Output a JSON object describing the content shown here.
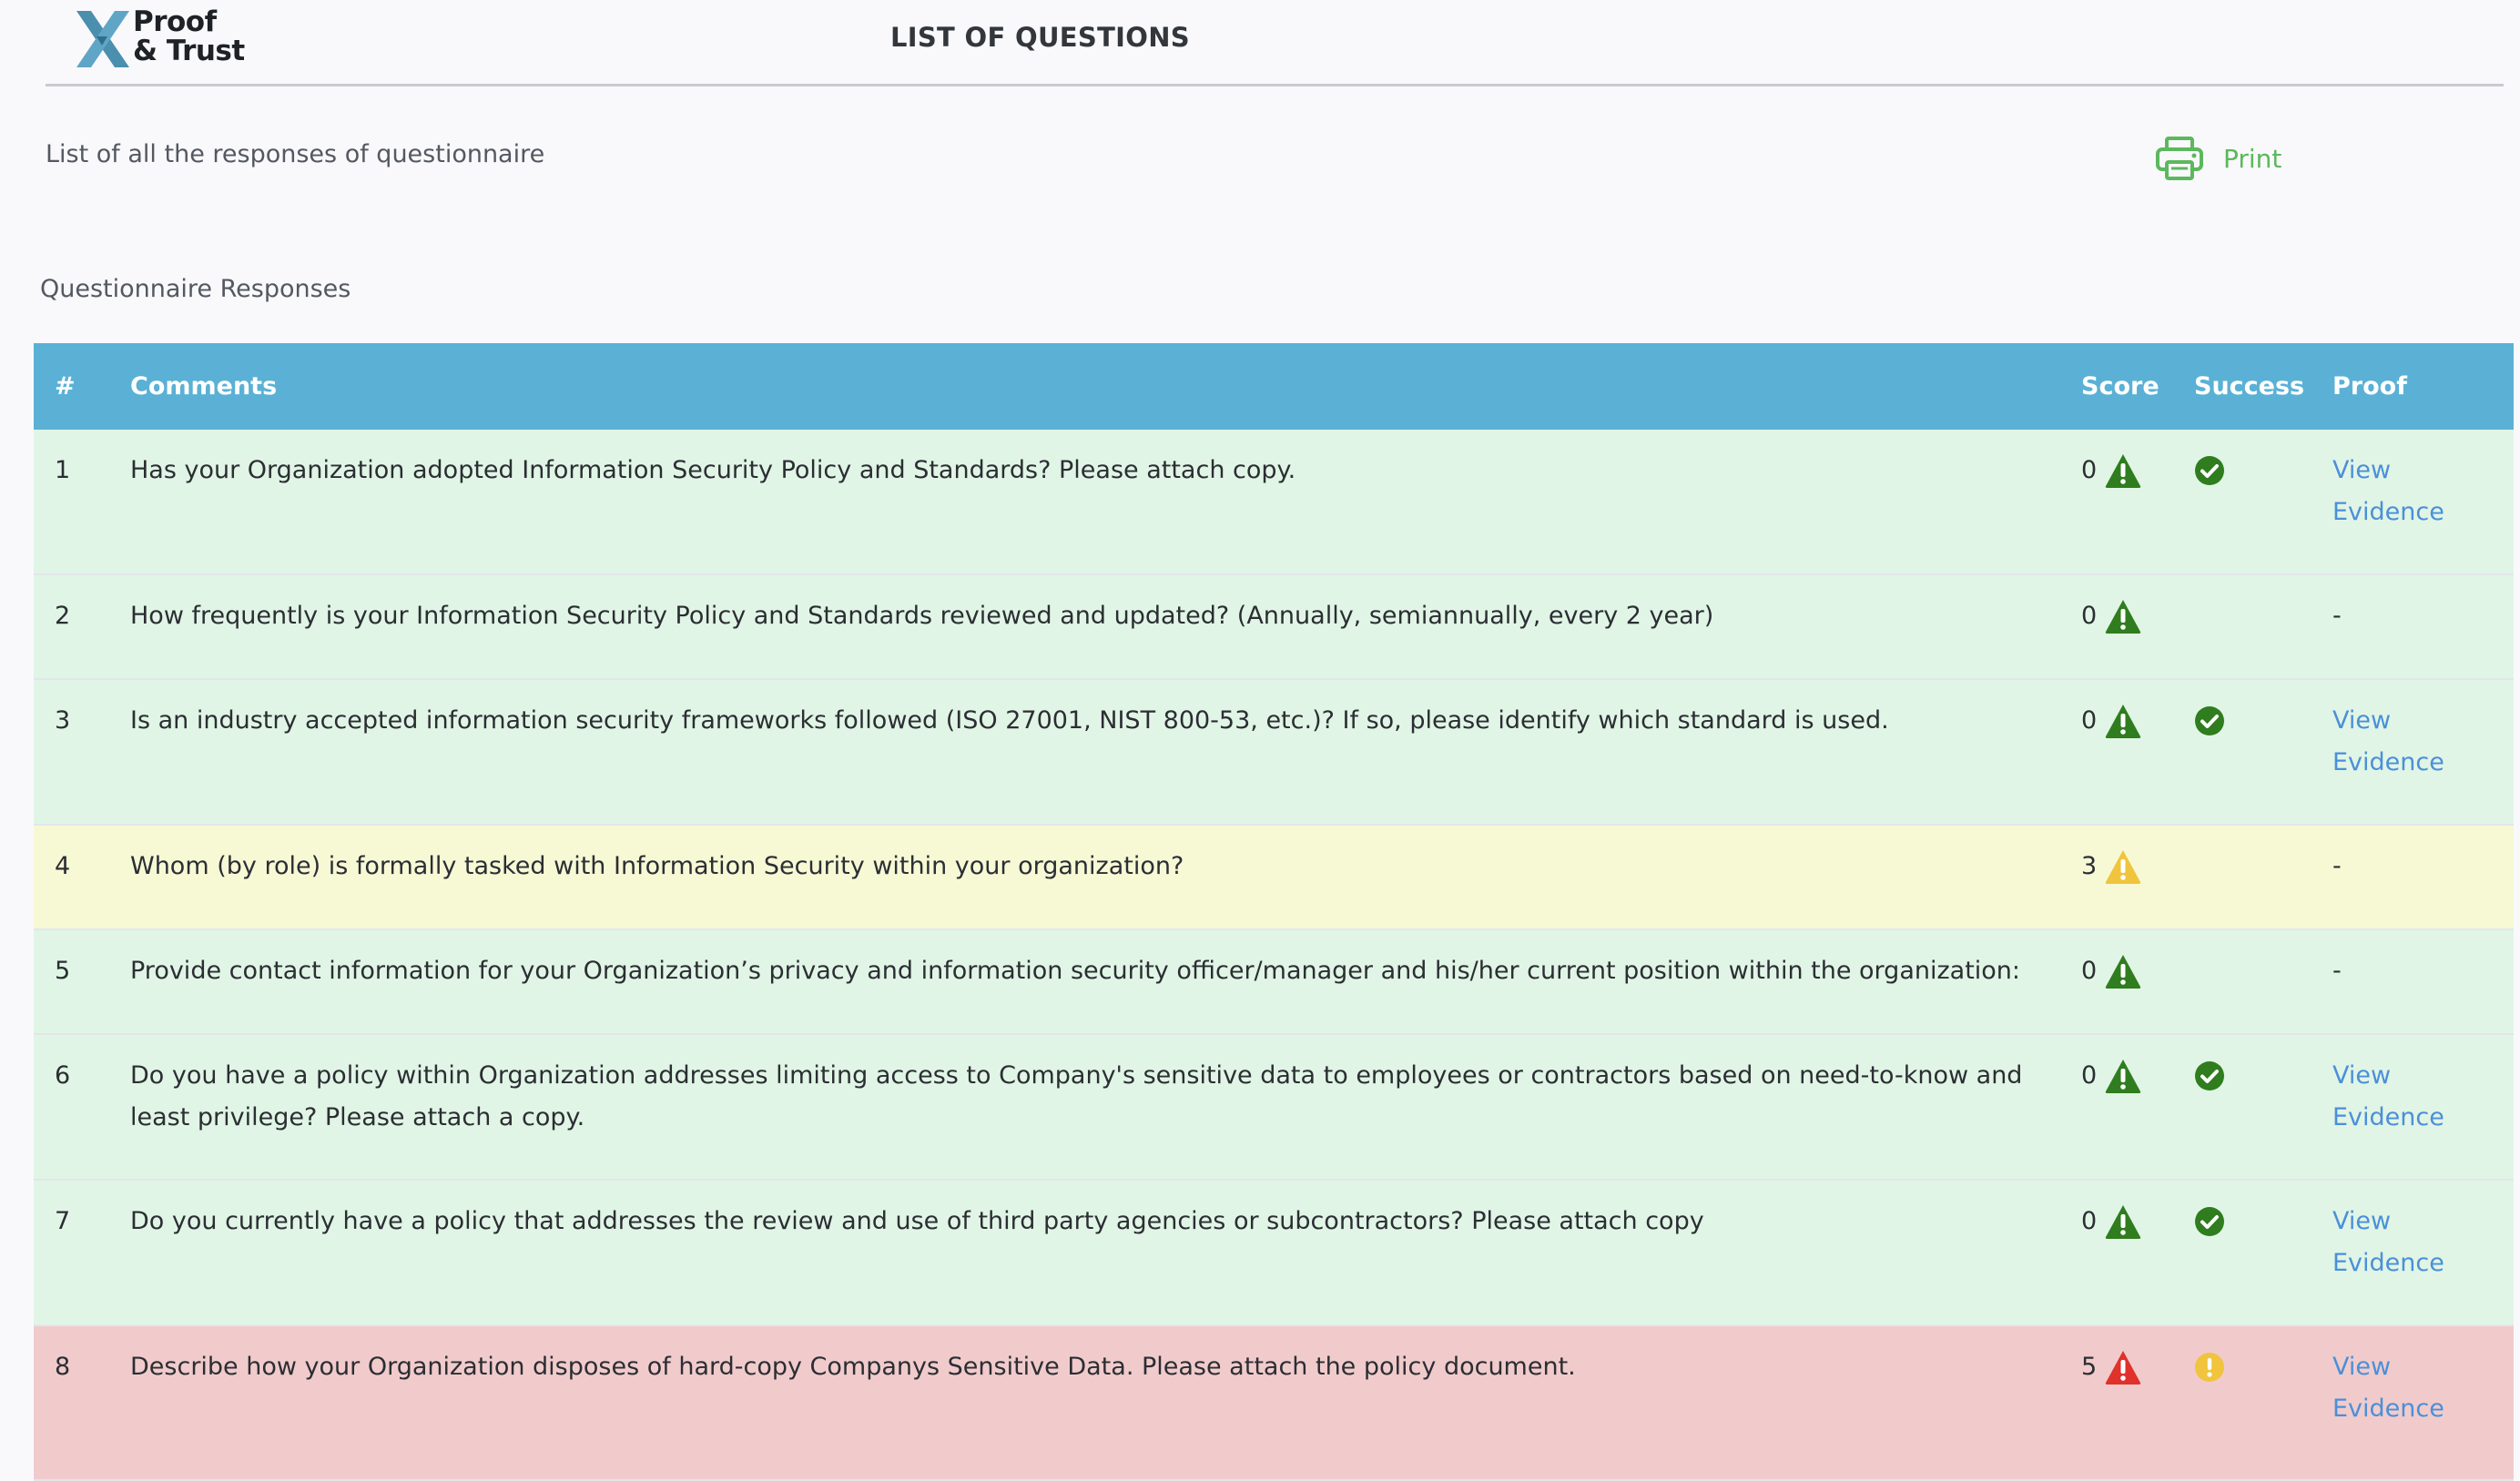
{
  "header": {
    "logo_line1": "Proof",
    "logo_line2": "& Trust",
    "title": "LIST OF QUESTIONS"
  },
  "subtitle": "List of all the responses of questionnaire",
  "print_label": "Print",
  "section_title": "Questionnaire Responses",
  "colors": {
    "header_bg": "#5ab1d5",
    "row_success": "#e1f5e6",
    "row_warning": "#f7f9d5",
    "row_danger": "#f1cbcc",
    "icon_green": "#2f7d1e",
    "icon_yellow": "#f0c43c",
    "icon_red": "#e0312b",
    "link": "#4a90d9",
    "print_green": "#5cb85c"
  },
  "table": {
    "headers": {
      "num": "#",
      "comments": "Comments",
      "score": "Score",
      "success": "Success",
      "proof": "Proof"
    },
    "rows": [
      {
        "num": "1",
        "comment": "Has your Organization adopted Information Security Policy and Standards? Please attach copy.",
        "score": "0",
        "level": "success",
        "status_icon": "check-circle-icon",
        "proof": [
          "View",
          "Evidence"
        ]
      },
      {
        "num": "2",
        "comment": "How frequently is your Information Security Policy and Standards reviewed and updated? (Annually, semiannually, every 2 year)",
        "score": "0",
        "level": "success",
        "status_icon": "",
        "proof": "-"
      },
      {
        "num": "3",
        "comment": "Is an industry accepted information security frameworks followed (ISO 27001, NIST 800-53, etc.)? If so, please identify which standard is used.",
        "score": "0",
        "level": "success",
        "status_icon": "check-circle-icon",
        "proof": [
          "View",
          "Evidence"
        ]
      },
      {
        "num": "4",
        "comment": "Whom (by role) is formally tasked with Information Security within your organization?",
        "score": "3",
        "level": "warning",
        "status_icon": "",
        "proof": "-"
      },
      {
        "num": "5",
        "comment": "Provide contact information for your Organization’s privacy and information security officer/manager and his/her current position within the organization:",
        "score": "0",
        "level": "success",
        "status_icon": "",
        "proof": "-"
      },
      {
        "num": "6",
        "comment": "Do you have a policy within Organization addresses limiting access to Company's sensitive data to employees or contractors based on need-to-know and least privilege? Please attach a copy.",
        "score": "0",
        "level": "success",
        "status_icon": "check-circle-icon",
        "proof": [
          "View",
          "Evidence"
        ]
      },
      {
        "num": "7",
        "comment": "Do you currently have a policy that addresses the review and use of third party agencies or subcontractors? Please attach copy",
        "score": "0",
        "level": "success",
        "status_icon": "check-circle-icon",
        "proof": [
          "View",
          "Evidence"
        ]
      },
      {
        "num": "8",
        "comment": "Describe how your Organization disposes of hard-copy Companys Sensitive Data. Please attach the policy document.",
        "score": "5",
        "level": "danger",
        "status_icon": "exclamation-circle-icon",
        "proof": [
          "View",
          "Evidence"
        ]
      }
    ]
  }
}
